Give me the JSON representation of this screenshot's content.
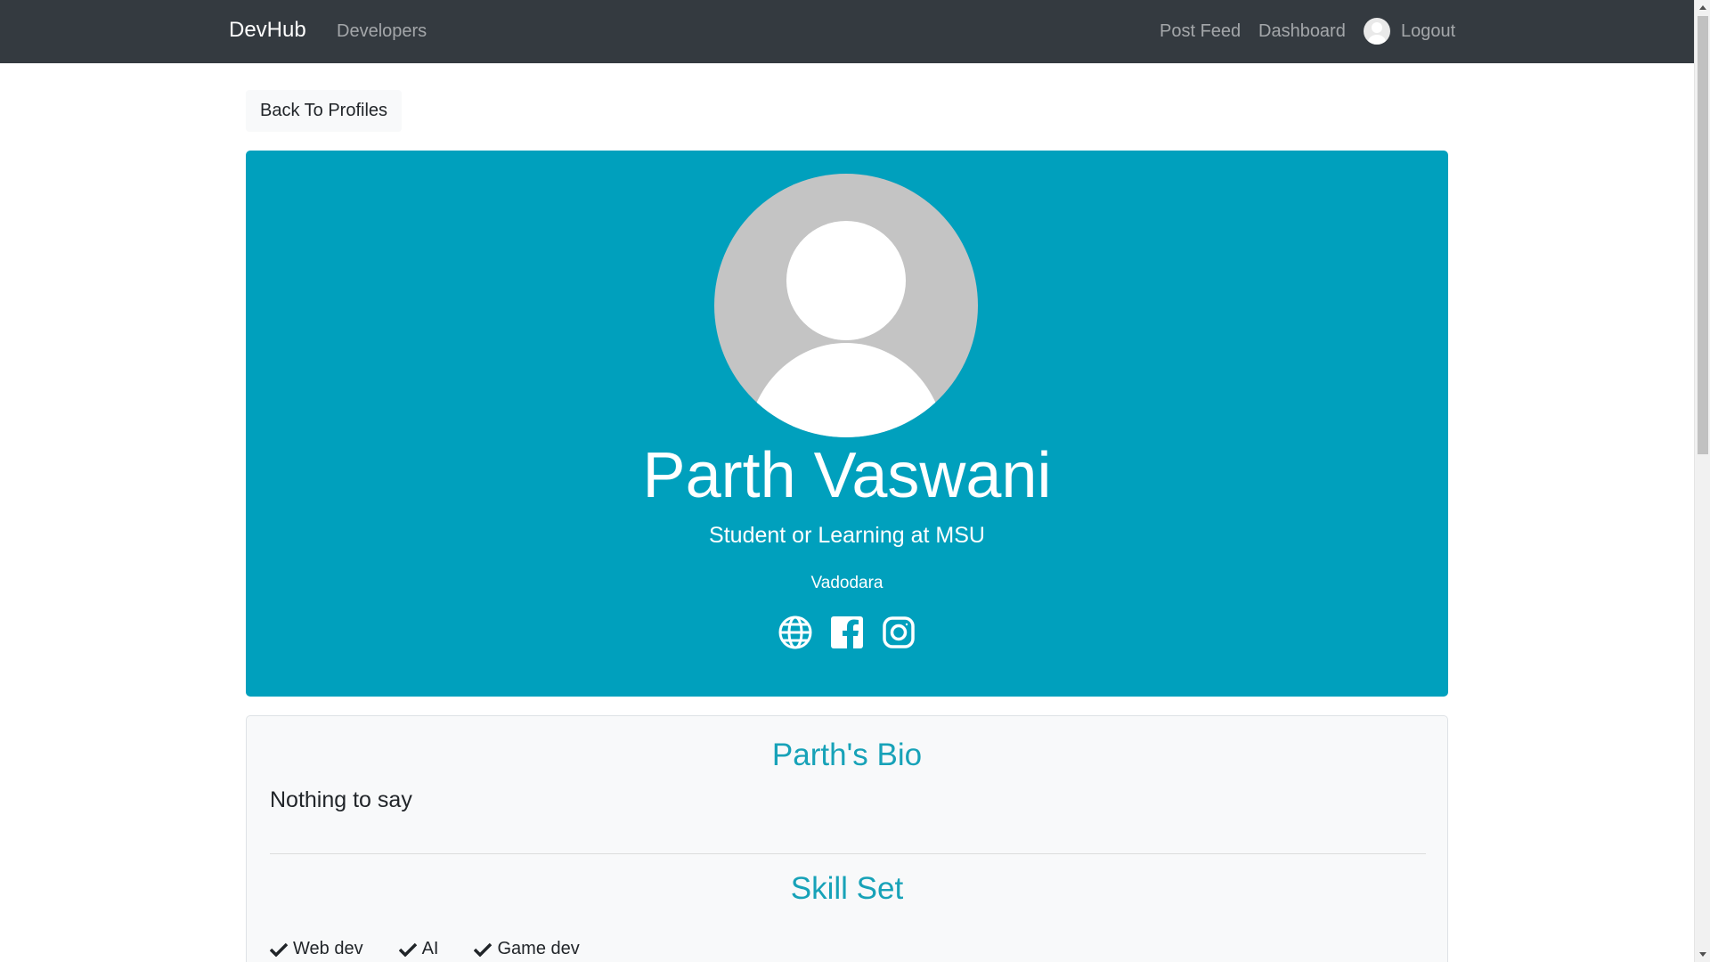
{
  "navbar": {
    "brand": "DevHub",
    "developers": "Developers",
    "post_feed": "Post Feed",
    "dashboard": "Dashboard",
    "logout": "Logout"
  },
  "back_button": "Back To Profiles",
  "profile": {
    "name": "Parth Vaswani",
    "status": "Student or Learning at MSU",
    "location": "Vadodara",
    "social_icons": [
      "globe-icon",
      "facebook-icon",
      "instagram-icon"
    ]
  },
  "bio": {
    "title": "Parth's Bio",
    "text": "Nothing to say"
  },
  "skills": {
    "title": "Skill Set",
    "items": [
      "Web dev",
      "AI",
      "Game dev"
    ]
  },
  "colors": {
    "navbar_bg": "#343a40",
    "profile_bg": "#00a0bd",
    "accent": "#17a2b8"
  }
}
